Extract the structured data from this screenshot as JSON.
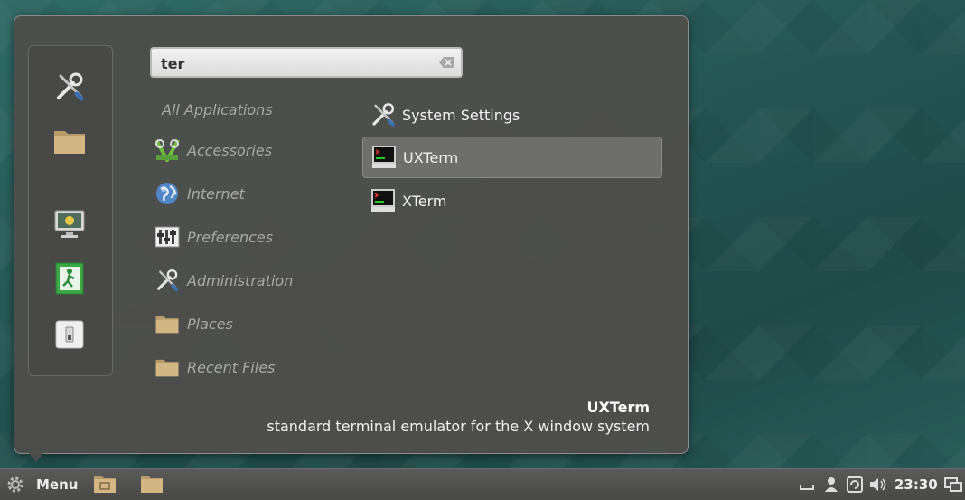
{
  "search": {
    "value": "ter",
    "placeholder": ""
  },
  "favorites": [
    {
      "name": "system-settings",
      "icon": "wrench-screwdriver-icon"
    },
    {
      "name": "files",
      "icon": "folder-icon"
    },
    {
      "name": "lock-screen",
      "icon": "lock-screen-icon"
    },
    {
      "name": "logout",
      "icon": "exit-icon"
    },
    {
      "name": "shutdown",
      "icon": "power-icon"
    }
  ],
  "categories": [
    {
      "label": "All Applications",
      "icon": ""
    },
    {
      "label": "Accessories",
      "icon": "accessories-icon"
    },
    {
      "label": "Internet",
      "icon": "globe-icon"
    },
    {
      "label": "Preferences",
      "icon": "preferences-icon"
    },
    {
      "label": "Administration",
      "icon": "wrench-screwdriver-icon"
    },
    {
      "label": "Places",
      "icon": "folder-icon"
    },
    {
      "label": "Recent Files",
      "icon": "folder-icon"
    }
  ],
  "apps": [
    {
      "label": "System Settings",
      "icon": "wrench-screwdriver-icon",
      "selected": false
    },
    {
      "label": "UXTerm",
      "icon": "terminal-icon",
      "selected": true
    },
    {
      "label": "XTerm",
      "icon": "terminal-icon",
      "selected": false
    }
  ],
  "description": {
    "title": "UXTerm",
    "text": "standard terminal emulator for the X window system"
  },
  "panel": {
    "menu_label": "Menu",
    "clock": "23:30"
  }
}
